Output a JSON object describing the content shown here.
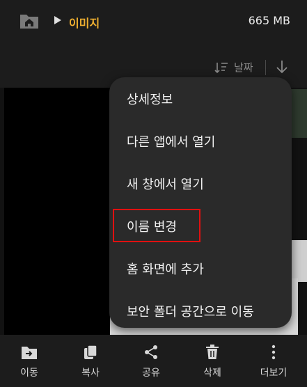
{
  "header": {
    "breadcrumb": "이미지",
    "storage": "665 MB"
  },
  "sort": {
    "label": "날짜"
  },
  "context_menu": {
    "items": [
      "상세정보",
      "다른 앱에서 열기",
      "새 창에서 열기",
      "이름 변경",
      "홈 화면에 추가",
      "보안 폴더 공간으로 이동"
    ]
  },
  "bottom_bar": {
    "move": "이동",
    "copy": "복사",
    "share": "공유",
    "delete": "삭제",
    "more": "더보기"
  },
  "colors": {
    "accent": "#f0b030",
    "highlight": "#e01010",
    "background": "#1c1c1c",
    "menu": "#2a2a2a"
  },
  "icons": [
    "home-icon",
    "breadcrumb-arrow-icon",
    "sort-icon",
    "sort-direction-icon",
    "move-icon",
    "copy-icon",
    "share-icon",
    "delete-icon",
    "more-icon"
  ]
}
